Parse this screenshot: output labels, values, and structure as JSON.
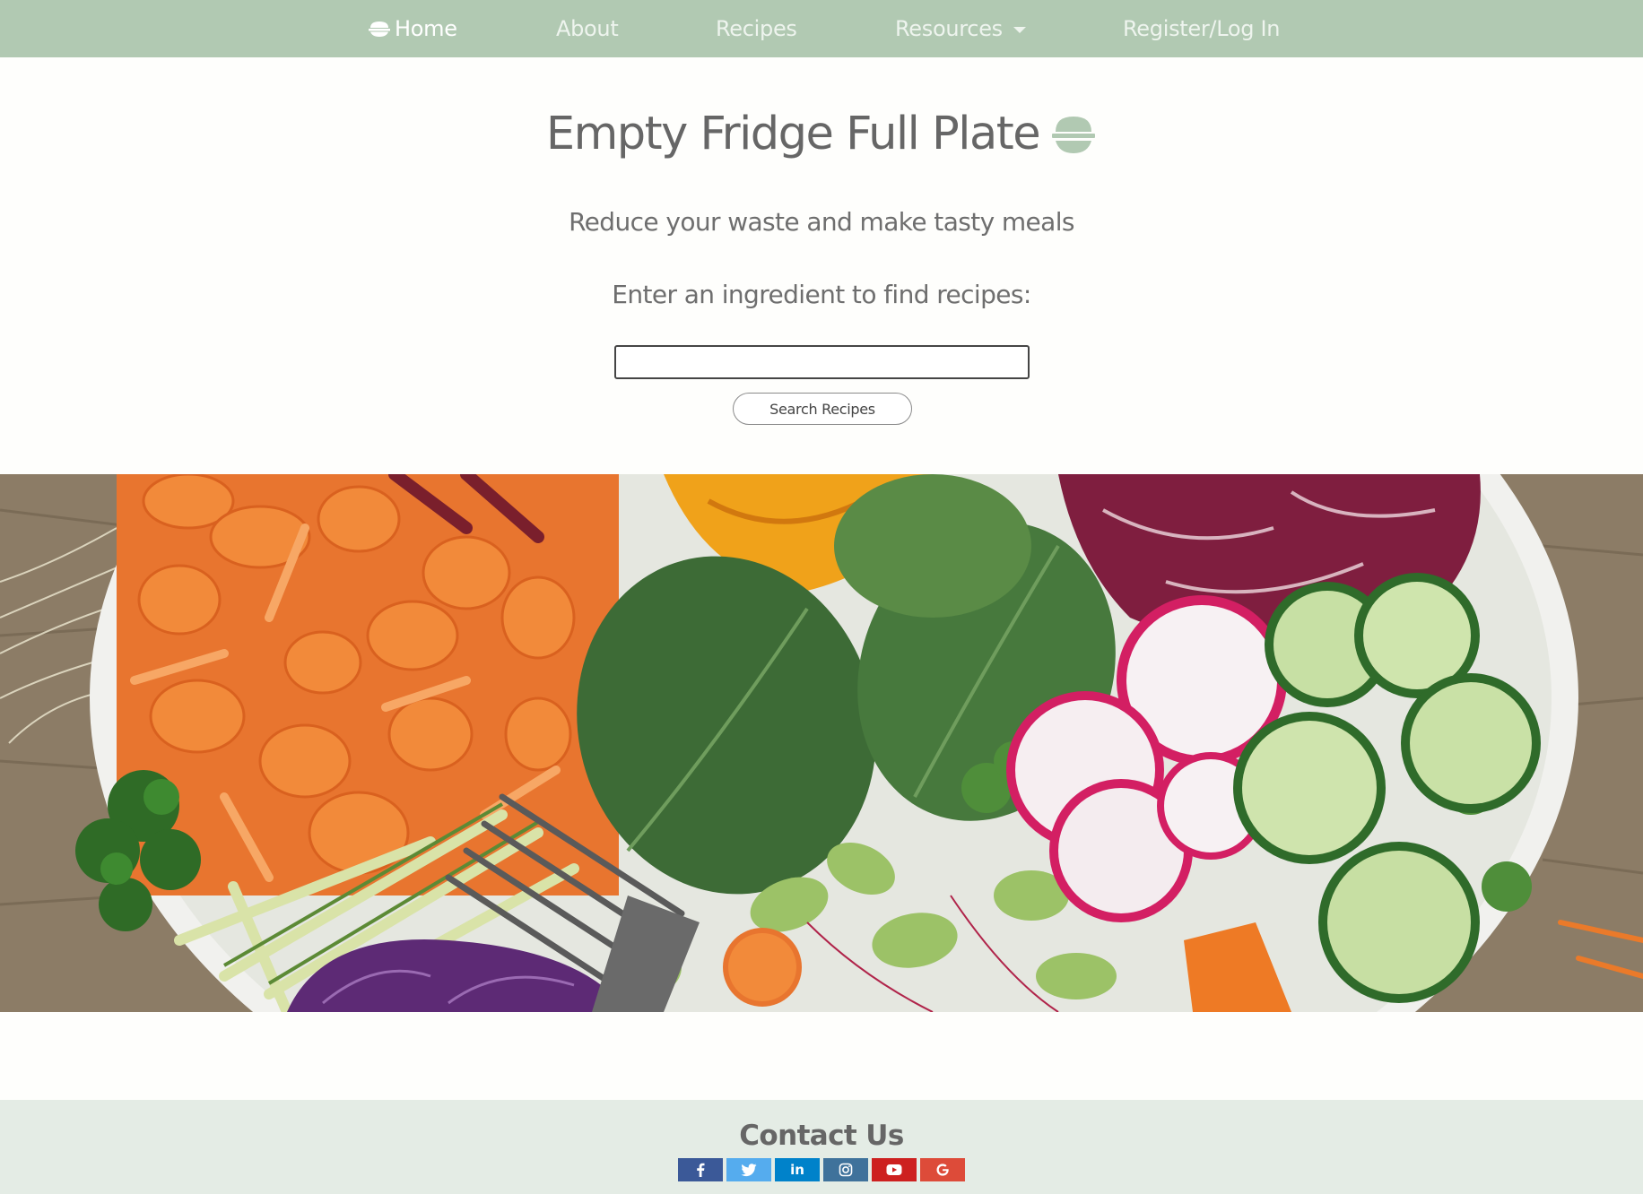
{
  "nav": {
    "items": [
      {
        "label": "Home",
        "active": true
      },
      {
        "label": "About"
      },
      {
        "label": "Recipes"
      },
      {
        "label": "Resources",
        "dropdown": true
      },
      {
        "label": "Register/Log In"
      }
    ]
  },
  "hero": {
    "title": "Empty Fridge Full Plate",
    "subtitle": "Reduce your waste and make tasty meals",
    "prompt": "Enter an ingredient to find recipes:",
    "search_value": "",
    "search_button": "Search Recipes",
    "logo_icon": "salad-bowl-icon"
  },
  "image": {
    "description_icon": "salad-bowl-photo"
  },
  "footer": {
    "title": "Contact Us",
    "socials": [
      {
        "icon": "facebook-icon",
        "color": "#3b5998"
      },
      {
        "icon": "twitter-icon",
        "color": "#55acee"
      },
      {
        "icon": "linkedin-icon",
        "color": "#0082ca"
      },
      {
        "icon": "instagram-icon",
        "color": "#3f729b"
      },
      {
        "icon": "youtube-icon",
        "color": "#cd201f"
      },
      {
        "icon": "google-icon",
        "color": "#dd4b39"
      }
    ]
  },
  "colors": {
    "nav_bg": "#b1c9b2",
    "accent_green": "#b1c9b2",
    "footer_bg": "#e4ece5",
    "text": "#666666"
  }
}
